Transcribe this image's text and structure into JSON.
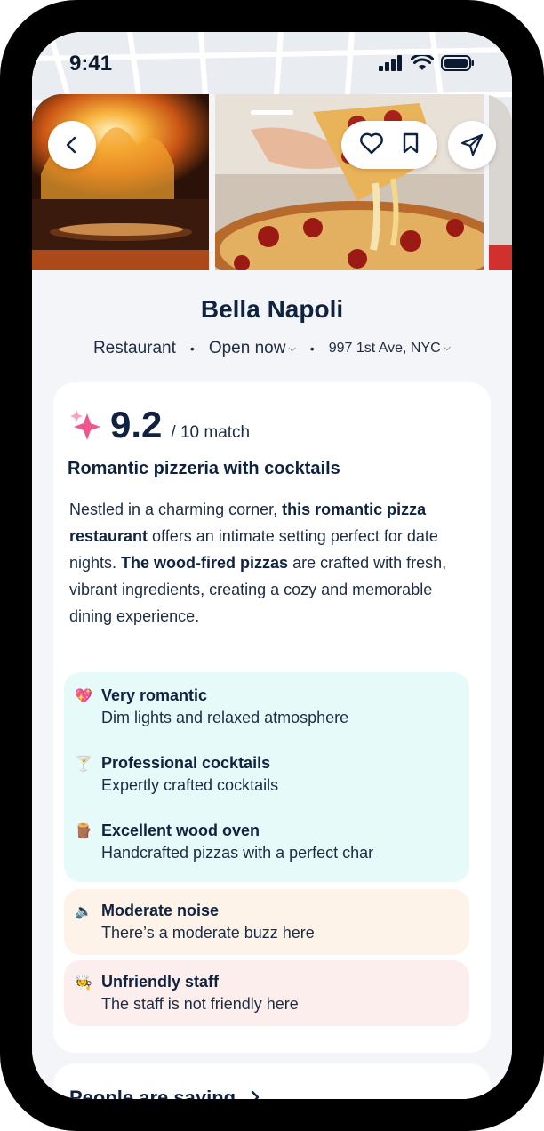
{
  "status_bar": {
    "time": "9:41"
  },
  "restaurant": {
    "name": "Bella Napoli",
    "category": "Restaurant",
    "open_status": "Open now",
    "address": "997 1st Ave, NYC"
  },
  "match": {
    "score": "9.2",
    "suffix": "/ 10 match",
    "headline": "Romantic pizzeria with cocktails",
    "desc_parts": [
      "Nestled in a charming corner, ",
      "this romantic pizza restaurant",
      " offers an intimate setting perfect for date nights. ",
      "The wood-fired pizzas",
      " are crafted with fresh, vibrant ingredients, creating a cozy and memorable dining experience."
    ]
  },
  "pros": [
    {
      "icon": "heart-sparkle-icon",
      "title": "Very romantic",
      "subtitle": "Dim lights and relaxed atmosphere"
    },
    {
      "icon": "cocktail-glass-icon",
      "title": "Professional cocktails",
      "subtitle": "Expertly crafted cocktails"
    },
    {
      "icon": "wood-log-icon",
      "title": "Excellent wood oven",
      "subtitle": "Handcrafted pizzas with a perfect char"
    }
  ],
  "cons": [
    {
      "icon": "speaker-icon",
      "title": "Moderate noise",
      "subtitle": "There’s a moderate buzz here"
    },
    {
      "icon": "chef-icon",
      "title": "Unfriendly staff",
      "subtitle": "The staff is not friendly here"
    }
  ],
  "people_saying": {
    "label": "People are saying"
  },
  "colors": {
    "pros_bg": "#e6fafa",
    "noise_bg": "#fdf3e8",
    "staff_bg": "#fdeeee",
    "text_dark": "#0f2340"
  }
}
